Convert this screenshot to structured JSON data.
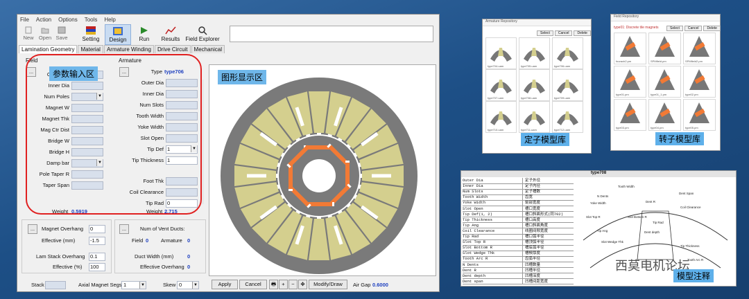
{
  "menu": [
    "File",
    "Action",
    "Options",
    "Tools",
    "Help"
  ],
  "toolbar": {
    "new": "New",
    "open": "Open",
    "save": "Save",
    "setting": "Setting",
    "design": "Design",
    "run": "Run",
    "results": "Results",
    "field_explorer": "Field Explorer"
  },
  "tabs": [
    "Lamination Geometry",
    "Material",
    "Armature Winding",
    "Drive Circuit",
    "Mechanical"
  ],
  "field": {
    "title": "Field",
    "rows": [
      "Outer Dia",
      "Inner Dia",
      "Num Poles",
      "Magnet W",
      "Magnet Thk",
      "Mag Ctr Dist",
      "Bridge W",
      "Bridge H",
      "Damp bar",
      "Pole Taper R",
      "Taper Span"
    ],
    "weight_label": "Weight",
    "weight": "0.5919"
  },
  "armature": {
    "title": "Armature",
    "type_label": "Type",
    "type": "type706",
    "rows": [
      "Outer Dia",
      "Inner Dia",
      "Num Slots",
      "Tooth Width",
      "Yoke Width",
      "Slot Open",
      "Tip Def",
      "Tip Thickness",
      "Foot Thk",
      "Coil Clearance",
      "Tip Rad"
    ],
    "tip_def_value": "1",
    "tip_thickness_value": "1",
    "tip_rad_value": "0",
    "weight_label": "Weight",
    "weight": "2.715"
  },
  "lower": {
    "magnet_overhang": "Magnet Overhang",
    "magnet_overhang_value": "0",
    "effective_mm": "Effective (mm)",
    "effective_mm_value": "-1.5",
    "lam_stack": "Lam Stack Overhang",
    "lam_stack_value": "0.1",
    "effective_pct": "Effective (%)",
    "effective_pct_value": "100",
    "vent_ducts": "Num of Vent Ducts:",
    "field": "Field",
    "field_value": "0",
    "armature": "Armature",
    "armature_value": "0",
    "duct_width": "Duct Width (mm)",
    "duct_width_value": "0",
    "effective_overhang": "Effective Overhang",
    "effective_overhang_value": "0"
  },
  "bottom": {
    "stack": "Stack",
    "axial_segs": "Axial Magnet Segs",
    "axial_segs_value": "1",
    "skew": "Skew",
    "skew_value": "0",
    "apply": "Apply",
    "cancel": "Cancel",
    "modify": "Modify/Draw",
    "air_gap_label": "Air Gap",
    "air_gap": "0.6000"
  },
  "callouts": {
    "input": "参数输入区",
    "display": "图形显示区"
  },
  "stator_repo": {
    "title": "Armature Repository",
    "label": "定子模型库",
    "buttons": [
      "Select",
      "Cancel",
      "Delete"
    ],
    "captions": [
      "type704.uam",
      "type705.uam",
      "type706.uam",
      "type707.uam",
      "type708.uam",
      "type709.uam",
      "type710.uam",
      "type711.uam",
      "type712.uam",
      "type713.uam"
    ]
  },
  "rotor_repo": {
    "title": "Field Repository",
    "header": "type01: Discrete tile magnets",
    "label": "转子模型库",
    "buttons": [
      "Select",
      "Cancel",
      "Delete"
    ],
    "captions": [
      "fouracb2.pm",
      "SPMfield.pm",
      "SPMfield2.pm",
      "type01.pm",
      "type01_1.pm",
      "type02.pm",
      "type03.pm",
      "type04.pm",
      "type05.pm"
    ]
  },
  "model": {
    "title": "type708",
    "label": "模型注释",
    "watermark": "西莫电机论坛",
    "rows": [
      [
        "Outer Dia",
        "定子外径"
      ],
      [
        "Inner Dia",
        "定子内径"
      ],
      [
        "Num Slots",
        "定子槽数"
      ],
      [
        "Tooth Width",
        "齿宽"
      ],
      [
        "Yoke Width",
        "轭部宽度"
      ],
      [
        "Slot Open",
        "槽口宽度"
      ],
      [
        "Tip Def(1, 2)",
        "槽口斜面形式(同702)"
      ],
      [
        "Tip Thickness",
        "槽口高度"
      ],
      [
        "Tip Ang",
        "槽口斜面角度"
      ],
      [
        "Coil Clearance",
        "线圈间隙宽度"
      ],
      [
        "Tip Rad",
        "槽口弧半径"
      ],
      [
        "Slot Top R",
        "槽顶弧半径"
      ],
      [
        "Slot Bottom R",
        "槽底弧半径"
      ],
      [
        "Slot Wedge Thk",
        "槽楔厚度"
      ],
      [
        "Tooth Arc R",
        "齿弧半径"
      ],
      [
        "N Dents",
        "凹槽数量"
      ],
      [
        "Dent R",
        "凹槽半径"
      ],
      [
        "Dent depth",
        "凹槽深度"
      ],
      [
        "Dent span",
        "凹槽间距宽度"
      ]
    ],
    "diagram_labels": [
      "Tooth Width",
      "N Dents",
      "Yoke Width",
      "Dent Span",
      "Coil Clearance",
      "Dent R",
      "Slot Top R",
      "Slot Bottom R",
      "Tip Rad",
      "Tip Ang",
      "Dent depth",
      "Slot Wedge Thk",
      "Tip Thickness",
      "Tooth Arc R"
    ]
  },
  "colors": {
    "bg": "#1d4f86",
    "callout": "#6fb7ea",
    "highlight_ring": "#e02020",
    "stator": "#7a7a7a",
    "slot_fill": "#d4cf8e",
    "magnet": "#f27a35"
  }
}
